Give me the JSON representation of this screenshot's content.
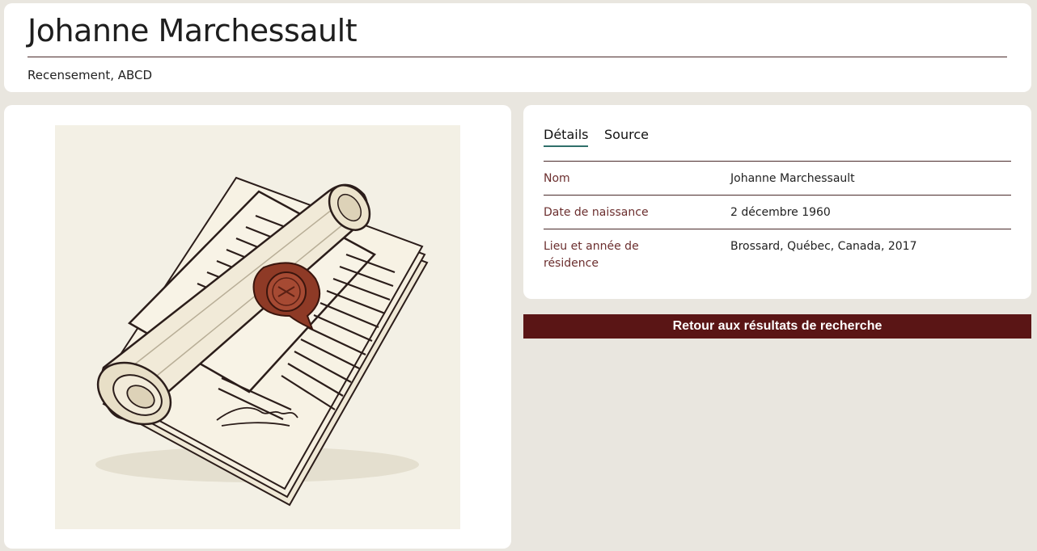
{
  "header": {
    "title": "Johanne Marchessault",
    "subtitle": "Recensement, ABCD"
  },
  "image": {
    "icon": "sealed-scroll-document-icon"
  },
  "tabs": [
    {
      "label": "Détails",
      "active": true
    },
    {
      "label": "Source",
      "active": false
    }
  ],
  "details": [
    {
      "label": "Nom",
      "value": "Johanne Marchessault"
    },
    {
      "label": "Date de naissance",
      "value": "2 décembre 1960"
    },
    {
      "label": "Lieu et année de résidence",
      "value": "Brossard, Québec, Canada, 2017"
    }
  ],
  "back_button": {
    "label": "Retour aux résultats de recherche"
  },
  "colors": {
    "background": "#e9e6df",
    "accent": "#5a1515",
    "label": "#6b2e2e",
    "tab_underline": "#2f6f6a"
  }
}
